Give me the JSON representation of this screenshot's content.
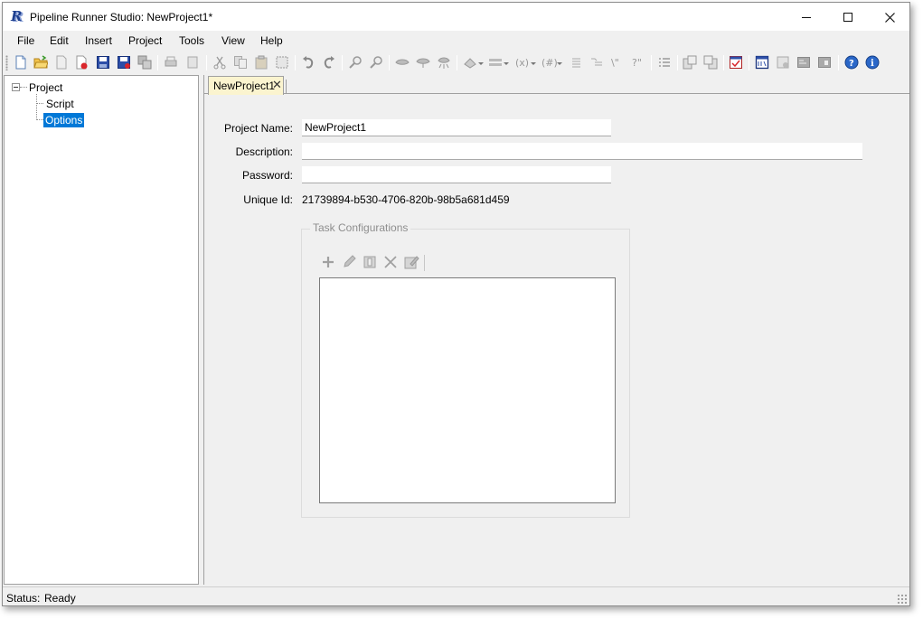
{
  "window": {
    "title": "Pipeline Runner Studio: NewProject1*",
    "app_icon_letter": "R"
  },
  "menu": [
    "File",
    "Edit",
    "Insert",
    "Project",
    "Tools",
    "View",
    "Help"
  ],
  "toolbar_icons": [
    "new-file-icon",
    "open-folder-icon",
    "close-file-icon",
    "delete-file-icon",
    "save-icon",
    "save-as-icon",
    "save-all-icon",
    "print-icon",
    "print-preview-icon",
    "cut-icon",
    "copy-icon",
    "paste-icon",
    "select-all-icon",
    "undo-icon",
    "redo-icon",
    "find-icon",
    "replace-icon",
    "run-icon",
    "step-icon",
    "debug-icon",
    "insert-task-icon",
    "insert-step-icon",
    "insert-variable-icon",
    "insert-block-icon",
    "indent-icon",
    "outdent-icon",
    "comment-icon",
    "uncomment-icon",
    "list-icon",
    "import-icon",
    "export-icon",
    "validate-icon",
    "console-icon",
    "settings-icon",
    "log-icon",
    "report-icon",
    "help-icon",
    "about-icon"
  ],
  "tree": {
    "root": "Project",
    "children": [
      "Script",
      "Options"
    ],
    "selected": "Options"
  },
  "tab": {
    "label": "NewProject1"
  },
  "form": {
    "project_name_label": "Project Name:",
    "project_name_value": "NewProject1",
    "description_label": "Description:",
    "description_value": "",
    "password_label": "Password:",
    "password_value": "",
    "unique_id_label": "Unique Id:",
    "unique_id_value": "21739894-b530-4706-820b-98b5a681d459"
  },
  "task_configurations": {
    "title": "Task Configurations",
    "toolbar_icons": [
      "add-icon",
      "edit-icon",
      "properties-icon",
      "delete-icon",
      "rename-icon"
    ],
    "items": []
  },
  "status": {
    "label": "Status:",
    "value": "Ready"
  },
  "colors": {
    "selection": "#0078d7",
    "tab_active": "#fbf4cf",
    "background": "#f0f0f0"
  }
}
